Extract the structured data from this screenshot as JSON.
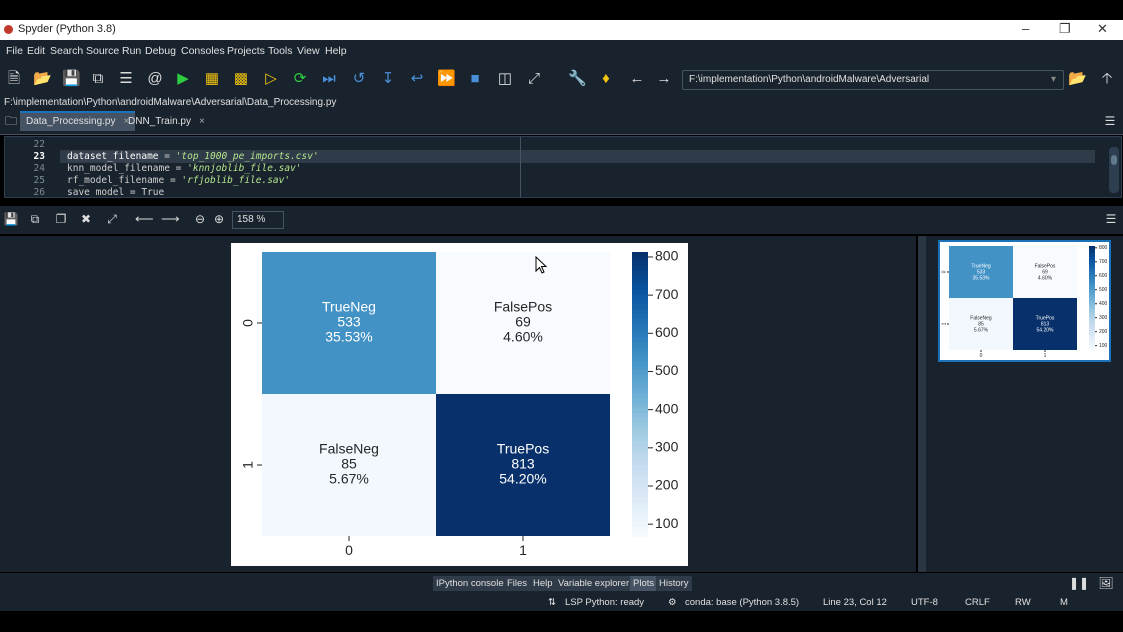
{
  "window": {
    "title": "Spyder (Python 3.8)"
  },
  "menu": [
    "File",
    "Edit",
    "Search",
    "Source",
    "Run",
    "Debug",
    "Consoles",
    "Projects",
    "Tools",
    "View",
    "Help"
  ],
  "toolbar": {
    "path": "F:\\implementation\\Python\\androidMalware\\Adversarial"
  },
  "editor": {
    "file_path": "F:\\implementation\\Python\\androidMalware\\Adversarial\\Data_Processing.py",
    "tabs": [
      {
        "label": "Data_Processing.py",
        "active": true
      },
      {
        "label": "DNN_Train.py",
        "active": false
      }
    ],
    "lines": [
      {
        "num": "22",
        "pre": "",
        "hl": "",
        "mid": "",
        "str": ""
      },
      {
        "num": "23",
        "pre": "",
        "hl": "dataset_filename",
        "mid": " = ",
        "str": "'top_1000_pe_imports.csv'"
      },
      {
        "num": "24",
        "pre": "knn_model_filename =",
        "hl": "",
        "mid": " ",
        "str": "'knnjoblib_file.sav'"
      },
      {
        "num": "25",
        "pre": "rf_model_filename =",
        "hl": "",
        "mid": " ",
        "str": "'rfjoblib_file.sav'"
      },
      {
        "num": "26",
        "pre": "save_model = True",
        "hl": "",
        "mid": "",
        "str": ""
      }
    ]
  },
  "plots": {
    "zoom": "158 %"
  },
  "chart_data": {
    "type": "heatmap",
    "x_ticks": [
      "0",
      "1"
    ],
    "y_ticks": [
      "0",
      "1"
    ],
    "cells": [
      {
        "label": "TrueNeg",
        "count": "533",
        "percent": "35.53%",
        "value": 533,
        "row": 0,
        "col": 0
      },
      {
        "label": "FalsePos",
        "count": "69",
        "percent": "4.60%",
        "value": 69,
        "row": 0,
        "col": 1
      },
      {
        "label": "FalseNeg",
        "count": "85",
        "percent": "5.67%",
        "value": 85,
        "row": 1,
        "col": 0
      },
      {
        "label": "TruePos",
        "count": "813",
        "percent": "54.20%",
        "value": 813,
        "row": 1,
        "col": 1
      }
    ],
    "colorbar": {
      "ticks": [
        100,
        200,
        300,
        400,
        500,
        600,
        700,
        800
      ],
      "range": [
        69,
        813
      ],
      "cmap": "Blues"
    },
    "colors": {
      "low": "#f7fbff",
      "high": "#08306b"
    }
  },
  "bottom_tabs": [
    "IPython console",
    "Files",
    "Help",
    "Variable explorer",
    "Plots",
    "History"
  ],
  "active_bottom_tab": "Plots",
  "status": {
    "lsp": "LSP Python: ready",
    "conda": "conda: base (Python 3.8.5)",
    "position": "Line 23, Col 12",
    "encoding": "UTF-8",
    "eol": "CRLF",
    "permissions": "RW",
    "memory": "M"
  }
}
